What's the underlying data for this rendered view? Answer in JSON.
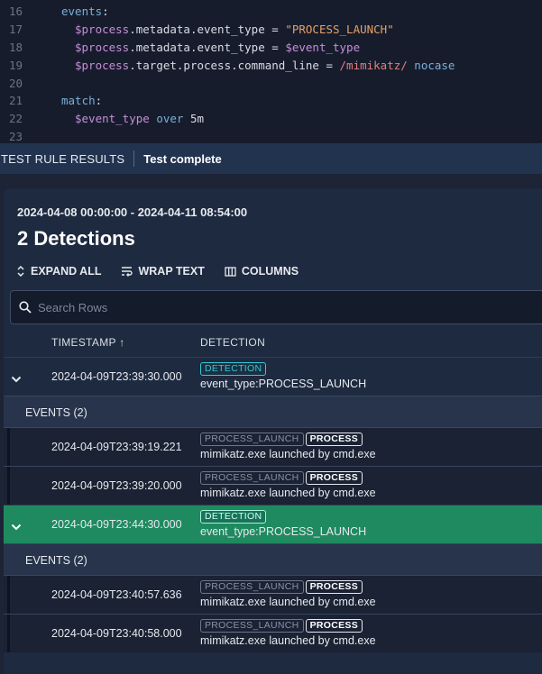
{
  "editor": {
    "lines": [
      {
        "num": "16",
        "parts": [
          {
            "t": "events",
            "c": "kw"
          },
          {
            "t": ":",
            "c": "plain"
          }
        ],
        "indent": 0
      },
      {
        "num": "17",
        "parts": [
          {
            "t": "$process",
            "c": "var"
          },
          {
            "t": ".metadata.event_type = ",
            "c": "plain"
          },
          {
            "t": "\"PROCESS_LAUNCH\"",
            "c": "str"
          }
        ],
        "indent": 1
      },
      {
        "num": "18",
        "parts": [
          {
            "t": "$process",
            "c": "var"
          },
          {
            "t": ".metadata.event_type = ",
            "c": "plain"
          },
          {
            "t": "$event_type",
            "c": "var"
          }
        ],
        "indent": 1
      },
      {
        "num": "19",
        "parts": [
          {
            "t": "$process",
            "c": "var"
          },
          {
            "t": ".target.process.command_line = ",
            "c": "plain"
          },
          {
            "t": "/mimikatz/",
            "c": "rx"
          },
          {
            "t": " nocase",
            "c": "nc"
          }
        ],
        "indent": 1
      },
      {
        "num": "20",
        "parts": [],
        "indent": 0
      },
      {
        "num": "21",
        "parts": [
          {
            "t": "match",
            "c": "kw"
          },
          {
            "t": ":",
            "c": "plain"
          }
        ],
        "indent": 0
      },
      {
        "num": "22",
        "parts": [
          {
            "t": "$event_type",
            "c": "var"
          },
          {
            "t": " over ",
            "c": "kw"
          },
          {
            "t": "5m",
            "c": "num"
          }
        ],
        "indent": 1
      },
      {
        "num": "23",
        "parts": [],
        "indent": 0
      }
    ]
  },
  "results_bar": {
    "title": "TEST RULE RESULTS",
    "status": "Test complete"
  },
  "panel": {
    "date_range": "2024-04-08 00:00:00 - 2024-04-11 08:54:00",
    "title": "2 Detections",
    "toolbar": {
      "expand_all": "EXPAND ALL",
      "wrap_text": "WRAP TEXT",
      "columns": "COLUMNS"
    },
    "search": {
      "placeholder": "Search Rows",
      "value": ""
    },
    "columns": {
      "timestamp": "TIMESTAMP ↑",
      "detection": "DETECTION"
    },
    "events_label": "EVENTS (2)",
    "detections": [
      {
        "timestamp": "2024-04-09T23:39:30.000",
        "badge": "DETECTION",
        "summary": "event_type:PROCESS_LAUNCH",
        "selected": false,
        "events": [
          {
            "timestamp": "2024-04-09T23:39:19.221",
            "badge1": "PROCESS_LAUNCH",
            "badge2": "PROCESS",
            "summary": "mimikatz.exe launched by cmd.exe"
          },
          {
            "timestamp": "2024-04-09T23:39:20.000",
            "badge1": "PROCESS_LAUNCH",
            "badge2": "PROCESS",
            "summary": "mimikatz.exe launched by cmd.exe"
          }
        ]
      },
      {
        "timestamp": "2024-04-09T23:44:30.000",
        "badge": "DETECTION",
        "summary": "event_type:PROCESS_LAUNCH",
        "selected": true,
        "events": [
          {
            "timestamp": "2024-04-09T23:40:57.636",
            "badge1": "PROCESS_LAUNCH",
            "badge2": "PROCESS",
            "summary": "mimikatz.exe launched by cmd.exe"
          },
          {
            "timestamp": "2024-04-09T23:40:58.000",
            "badge1": "PROCESS_LAUNCH",
            "badge2": "PROCESS",
            "summary": "mimikatz.exe launched by cmd.exe"
          }
        ]
      }
    ]
  },
  "colors": {
    "editor_bg": "#171c2c",
    "results_bar_bg": "#22334f",
    "panel_bg": "#1e2a3f",
    "selected_row": "#1f8a5f",
    "detection_badge": "#35c7d6"
  }
}
